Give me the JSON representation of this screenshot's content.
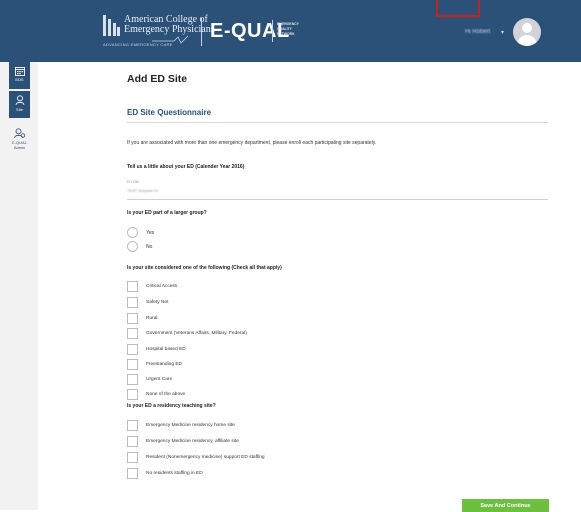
{
  "header": {
    "org_line1": "American College of",
    "org_line2": "Emergency Physicians",
    "org_url": "ADVANCING EMERGENCY CARE",
    "product": "E-QUAL",
    "product_sub1": "EMERGENCY",
    "product_sub2": "QUALITY",
    "product_sub3": "NETWORK",
    "user_name": "Hi Robert",
    "caret": "▾"
  },
  "sidebar": {
    "items": [
      {
        "label": "EDS",
        "icon": "calendar-icon"
      },
      {
        "label": "Site",
        "icon": "user-icon"
      },
      {
        "label_line1": "E-QUAL",
        "label_line2": "Admin",
        "icon": "admin-users-icon"
      }
    ]
  },
  "page": {
    "title": "Add ED Site",
    "section_title": "ED Site Questionnaire",
    "intro": "If you are associated with more than one emergency department, please enroll each participating site separately.",
    "q1_heading": "Tell us a little about your ED (Calender Year 2016)",
    "ed_name_label": "ED Site",
    "ed_name_value": "TEST Hospital 01",
    "q2_heading": "Is your ED part of a larger group?",
    "group_options": [
      "Yes",
      "No"
    ],
    "q3_heading": "Is your site considered one of the following (Check all that apply)",
    "site_types": [
      "Critical Access",
      "Safety Net",
      "Rural",
      "Government (Veterans Affairs, Military, Federal)",
      "Hospital based ED",
      "Freestanding ED",
      "Urgent Care",
      "None of the above"
    ],
    "q4_heading": "Is your ED a residency teaching site?",
    "residency_options": [
      "Emergency Medicine residency home site",
      "Emergency Medicine residency, affiliate site",
      "Resident (Nonemergency medicine) support ED staffing",
      "No residents staffing in ED"
    ],
    "save_label": "Save And Continue"
  },
  "colors": {
    "header_bg": "#2c5179",
    "accent": "#2c5179",
    "save_button": "#6dbf3f",
    "highlight_box": "#cc1f1f"
  }
}
